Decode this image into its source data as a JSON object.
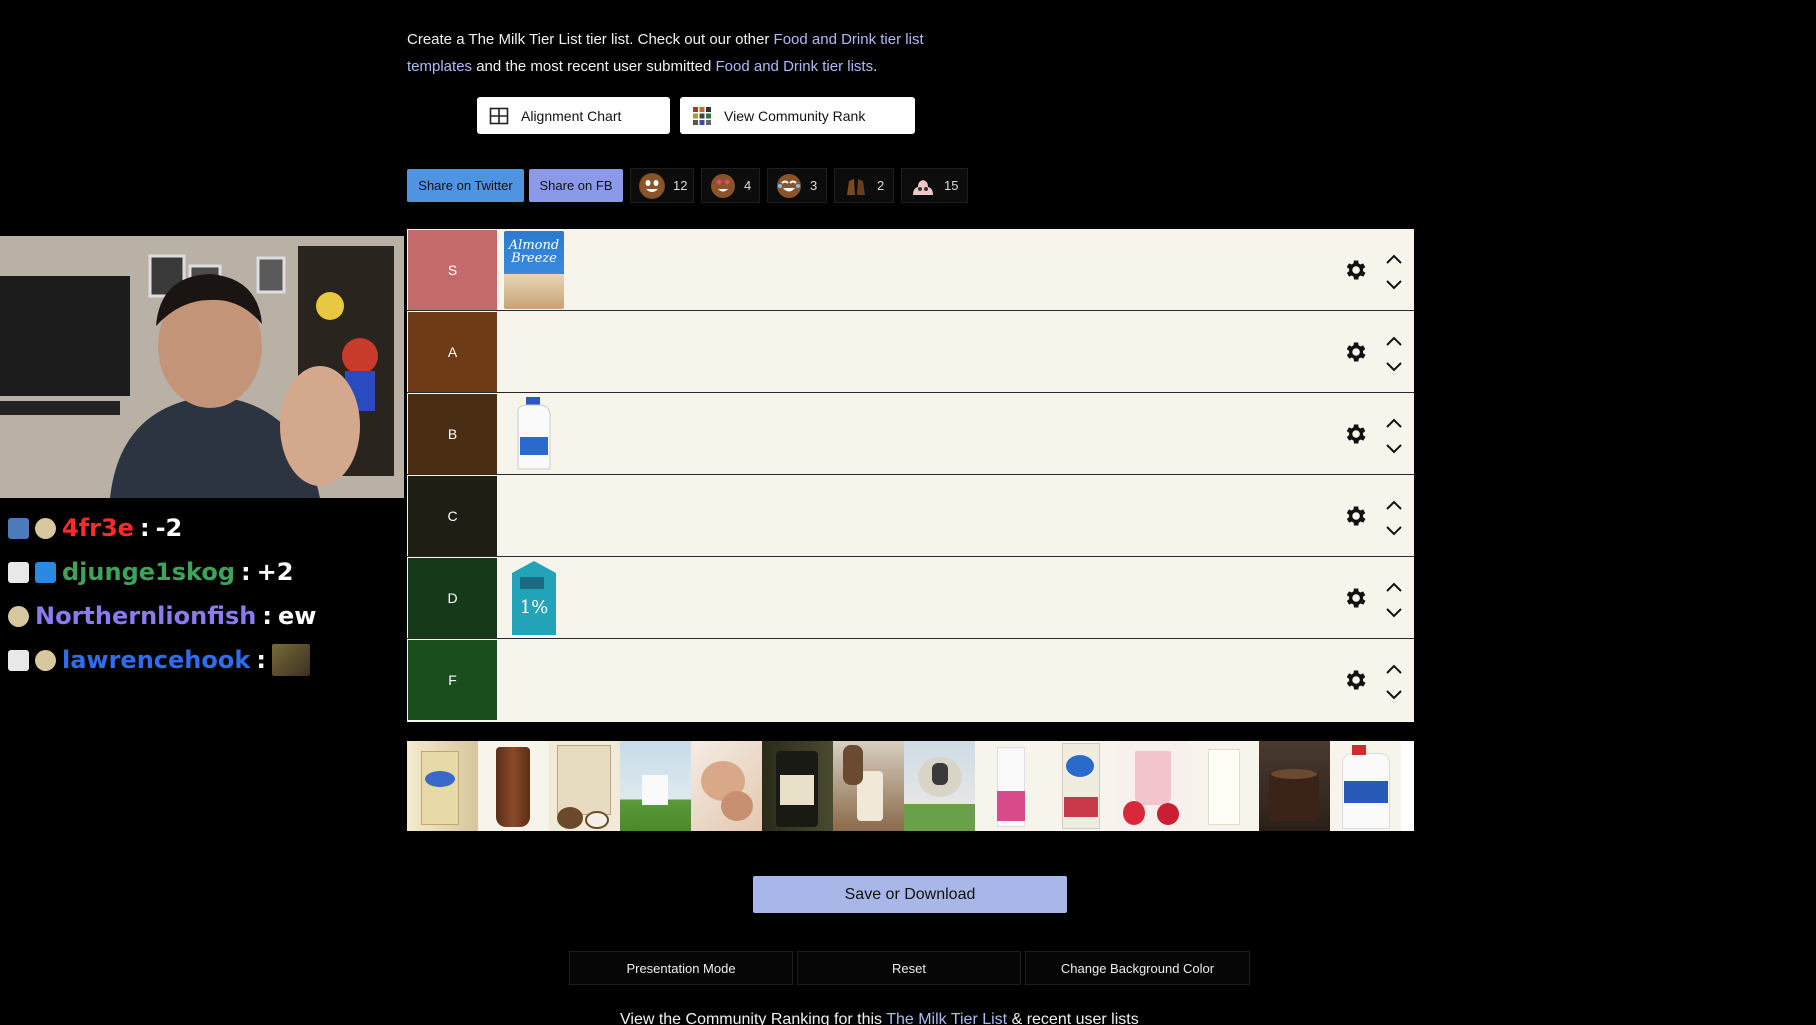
{
  "intro": {
    "text1": "Create a The Milk Tier List tier list. Check out our other ",
    "link1": "Food and Drink tier list templates",
    "text2": " and the most recent user submitted ",
    "link2": "Food and Drink tier lists",
    "text3": "."
  },
  "actions": {
    "alignment_chart": "Alignment Chart",
    "community_rank": "View Community Rank"
  },
  "share": {
    "twitter": "Share on Twitter",
    "fb": "Share on FB"
  },
  "reactions": [
    {
      "icon": "laughing-emoji-icon",
      "count": "12"
    },
    {
      "icon": "heart-eyes-emoji-icon",
      "count": "4"
    },
    {
      "icon": "crying-laughing-emoji-icon",
      "count": "3"
    },
    {
      "icon": "clapping-hands-icon",
      "count": "2"
    },
    {
      "icon": "poop-emoji-icon",
      "count": "15"
    }
  ],
  "tiers": [
    {
      "label": "S",
      "color": "#c46a6a"
    },
    {
      "label": "A",
      "color": "#6e3b16"
    },
    {
      "label": "B",
      "color": "#4a2e14"
    },
    {
      "label": "C",
      "color": "#1e1e14"
    },
    {
      "label": "D",
      "color": "#16391a"
    },
    {
      "label": "F",
      "color": "#1a4d1c"
    }
  ],
  "tier_items": {
    "S": "almond-breeze-carton",
    "B": "whole-milk-gallon-jug",
    "D": "one-percent-milk-carton"
  },
  "pool_items": [
    "oat-milk-carton",
    "chocolate-milk-glass",
    "coconut-milk-carton",
    "goat-milk",
    "breast-milk",
    "oat-milk-bottle",
    "milking-cow",
    "sheep-milk",
    "camel-milk",
    "silk-soy-milk",
    "strawberry-milk",
    "milk-glass",
    "chocolate-milk-cup",
    "skim-milk-jug"
  ],
  "buttons": {
    "save": "Save or Download",
    "presentation": "Presentation Mode",
    "reset": "Reset",
    "bg_color": "Change Background Color"
  },
  "footer": {
    "text1": "View the Community Ranking for this ",
    "link": "The Milk Tier List",
    "text2": " & recent user lists"
  },
  "chat": [
    {
      "user": "4fr3e",
      "color": "#ff2a2a",
      "msg": "-2"
    },
    {
      "user": "djunge1skog",
      "color": "#3ea35a",
      "msg": "+2"
    },
    {
      "user": "Northernlionfish",
      "color": "#8a7cf0",
      "msg": "ew"
    },
    {
      "user": "lawrencehook",
      "color": "#2f6cf0",
      "msg": ""
    }
  ],
  "colors": {
    "accent_link": "#aebcf5",
    "twitter": "#4f94e0",
    "fb": "#8a9ae8",
    "save": "#a9b7e8"
  }
}
